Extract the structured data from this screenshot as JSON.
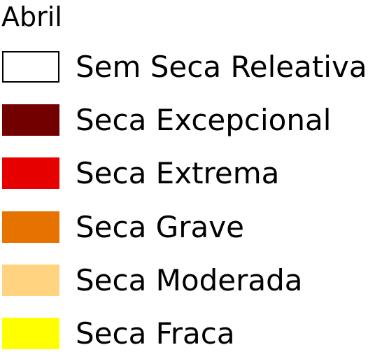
{
  "legend": {
    "title": "Abril",
    "items": [
      {
        "label": "Sem Seca Releativa",
        "color": "#ffffff",
        "outlined": true
      },
      {
        "label": "Seca Excepcional",
        "color": "#730000",
        "outlined": false
      },
      {
        "label": "Seca Extrema",
        "color": "#e60000",
        "outlined": false
      },
      {
        "label": "Seca Grave",
        "color": "#e67300",
        "outlined": false
      },
      {
        "label": "Seca Moderada",
        "color": "#ffd37f",
        "outlined": false
      },
      {
        "label": "Seca Fraca",
        "color": "#ffff00",
        "outlined": false
      }
    ]
  }
}
